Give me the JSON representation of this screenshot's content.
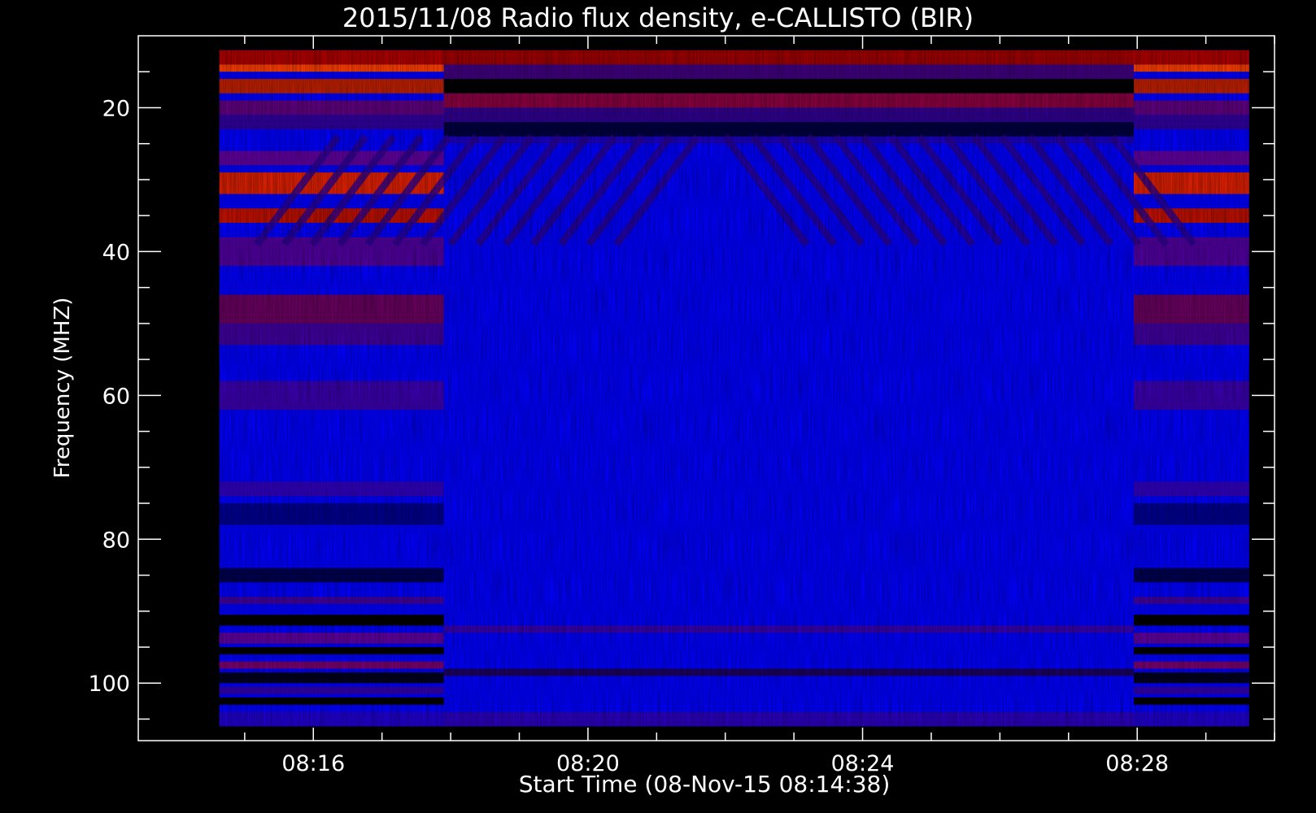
{
  "chart_data": {
    "type": "heatmap",
    "title": "2015/11/08  Radio flux density, e-CALLISTO (BIR)",
    "xlabel": "Start Time (08-Nov-15 08:14:38)",
    "ylabel": "Frequency (MHZ)",
    "x_tick_labels": [
      "08:16",
      "08:20",
      "08:24",
      "08:28"
    ],
    "x_tick_values_min": [
      16,
      20,
      24,
      28
    ],
    "y_tick_labels": [
      "20",
      "40",
      "60",
      "80",
      "100"
    ],
    "y_tick_values": [
      20,
      40,
      60,
      80,
      100
    ],
    "xlim_min": [
      13.45,
      30.0
    ],
    "ylim": [
      108,
      10
    ],
    "data_extent": {
      "time_start_min": 14.63,
      "time_end_min": 29.63,
      "freq_min_mhz": 12,
      "freq_max_mhz": 106
    },
    "colors": {
      "background": "#000000",
      "low": "#0000ff",
      "mid": "#b00000",
      "high": "#ffff00"
    },
    "grid": false
  }
}
